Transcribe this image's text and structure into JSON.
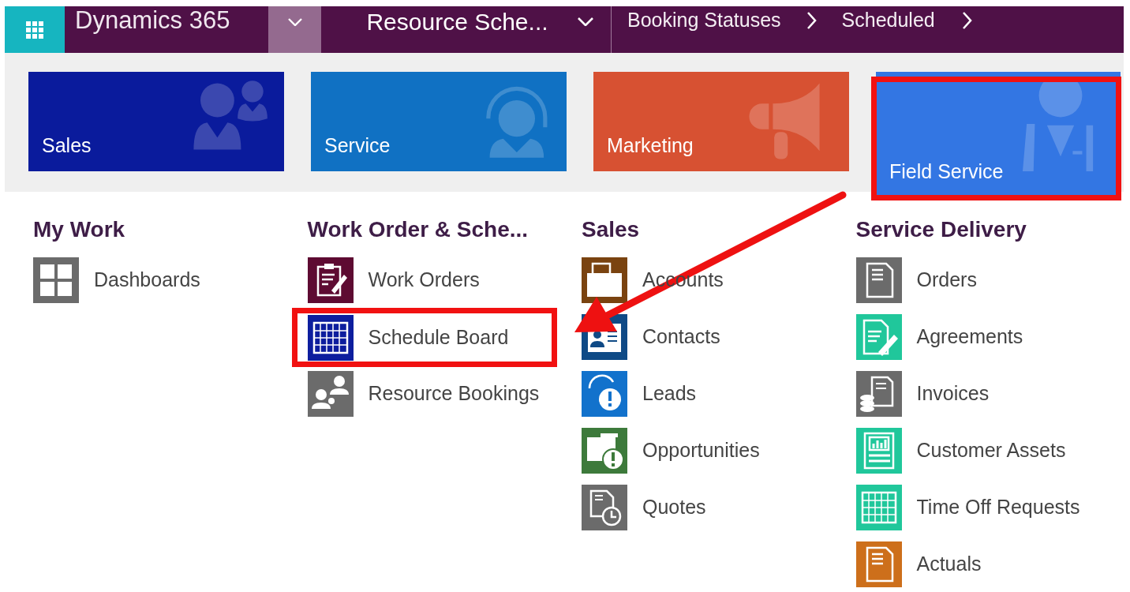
{
  "nav_bar": {
    "app_name": "Dynamics 365",
    "module": "Resource Sche...",
    "breadcrumbs": [
      "Booking Statuses",
      "Scheduled"
    ]
  },
  "tiles": [
    {
      "label": "Sales",
      "kind": "people",
      "color": "#0a1b9c",
      "selected": false
    },
    {
      "label": "Service",
      "kind": "headset",
      "color": "#1071c3",
      "selected": false
    },
    {
      "label": "Marketing",
      "kind": "megaphone",
      "color": "#d75132",
      "selected": false
    },
    {
      "label": "Field Service",
      "kind": "person",
      "color": "#3376e3",
      "selected": true
    }
  ],
  "groups": [
    {
      "title": "My Work",
      "items": [
        {
          "label": "Dashboards",
          "kind": "dashboard",
          "color": "#6b6b6b",
          "highlighted": false
        }
      ]
    },
    {
      "title": "Work Order & Sche...",
      "items": [
        {
          "label": "Work Orders",
          "kind": "clipboard",
          "color": "#5e0b32",
          "highlighted": false
        },
        {
          "label": "Schedule Board",
          "kind": "board",
          "color": "#0d1e9e",
          "highlighted": true
        },
        {
          "label": "Resource Bookings",
          "kind": "people",
          "color": "#6b6b6b",
          "highlighted": false
        }
      ]
    },
    {
      "title": "Sales",
      "items": [
        {
          "label": "Accounts",
          "kind": "account",
          "color": "#7a4310",
          "highlighted": false
        },
        {
          "label": "Contacts",
          "kind": "contact",
          "color": "#0f4a86",
          "highlighted": false
        },
        {
          "label": "Leads",
          "kind": "lead",
          "color": "#1272cc",
          "highlighted": false
        },
        {
          "label": "Opportunities",
          "kind": "opportunity",
          "color": "#3d7a3b",
          "highlighted": false
        },
        {
          "label": "Quotes",
          "kind": "quote",
          "color": "#6b6b6b",
          "highlighted": false
        }
      ]
    },
    {
      "title": "Service Delivery",
      "items": [
        {
          "label": "Orders",
          "kind": "document",
          "color": "#6b6b6b",
          "highlighted": false
        },
        {
          "label": "Agreements",
          "kind": "agreement",
          "color": "#20c79b",
          "highlighted": false
        },
        {
          "label": "Invoices",
          "kind": "invoice",
          "color": "#6b6b6b",
          "highlighted": false
        },
        {
          "label": "Customer Assets",
          "kind": "asset",
          "color": "#20c79b",
          "highlighted": false
        },
        {
          "label": "Time Off Requests",
          "kind": "grid",
          "color": "#20c79b",
          "highlighted": false
        },
        {
          "label": "Actuals",
          "kind": "document",
          "color": "#cd6f1b",
          "highlighted": false
        }
      ]
    }
  ]
}
